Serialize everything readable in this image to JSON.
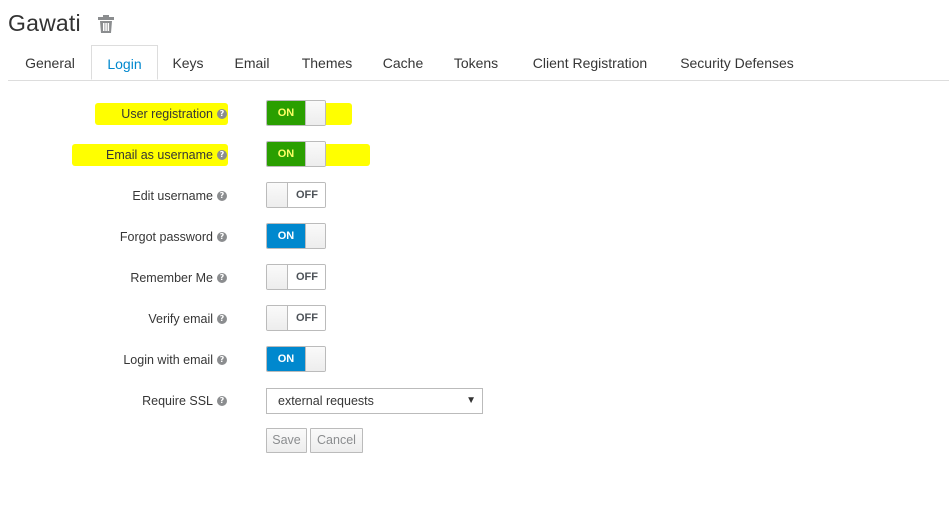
{
  "realm": {
    "title": "Gawati",
    "delete_icon": "trash-icon"
  },
  "tabs": [
    {
      "label": "General"
    },
    {
      "label": "Login",
      "active": true
    },
    {
      "label": "Keys"
    },
    {
      "label": "Email"
    },
    {
      "label": "Themes"
    },
    {
      "label": "Cache"
    },
    {
      "label": "Tokens"
    },
    {
      "label": "Client Registration"
    },
    {
      "label": "Security Defenses"
    }
  ],
  "settings": [
    {
      "label": "User registration",
      "state": "ON",
      "highlighted": true
    },
    {
      "label": "Email as username",
      "state": "ON",
      "highlighted": true
    },
    {
      "label": "Edit username",
      "state": "OFF"
    },
    {
      "label": "Forgot password",
      "state": "ON"
    },
    {
      "label": "Remember Me",
      "state": "OFF"
    },
    {
      "label": "Verify email",
      "state": "OFF"
    },
    {
      "label": "Login with email",
      "state": "ON"
    }
  ],
  "require_ssl": {
    "label": "Require SSL",
    "value": "external requests"
  },
  "actions": {
    "save": "Save",
    "cancel": "Cancel"
  },
  "colors": {
    "accent": "#0088ce",
    "highlight": "#ffff00",
    "highlight_on": "#2a9f00"
  }
}
